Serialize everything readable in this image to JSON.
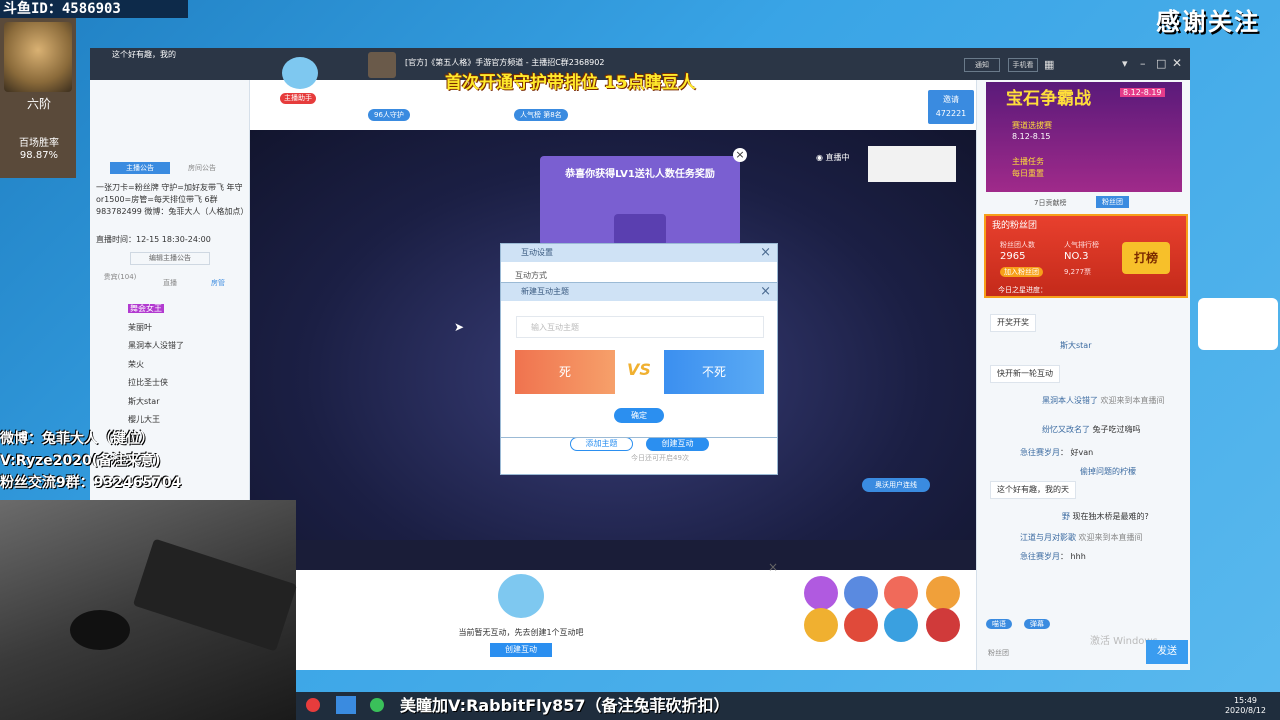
{
  "overlay": {
    "id_label": "斗鱼ID：4586903",
    "rank_label": "六阶",
    "winrate_label": "百场胜率",
    "winrate_value": "98.87%",
    "thank_text": "感谢关注",
    "banner_top": "首次开通守护带排位 15点瞎豆人",
    "weibo_line1": "微博：兔菲大人（键位）",
    "weibo_line2": "V:Ryze2020(备注来意)",
    "weibo_line3": "粉丝交流9群：932465704",
    "taskbar_text": "美瞳加V:RabbitFly857（备注兔菲砍折扣）"
  },
  "window": {
    "title": "[官方]《第五人格》手游官方频道 - 主播招C群2368902",
    "nick_badge": "主播助手",
    "guard": "96人守护",
    "popularity": "人气榜 第8名",
    "live_label": "直播中",
    "invite": "邀请",
    "invite_count": "472221",
    "notice_btn": "通知",
    "phone_btn": "手机看"
  },
  "left": {
    "greet": "这个好有趣，我的",
    "tab_notice": "主播公告",
    "tab_recent": "房间公告",
    "notice_text": "一张刀卡=粉丝牌 守护=加好友带飞 年守or1500=房管=每天排位带飞 6群983782499 微博：兔菲大人（人格加点）",
    "time_text": "直播时间：12-15 18:30-24:00",
    "edit_notice": "编辑主播公告",
    "tabs": [
      "贵宾(104)",
      "直播",
      "房管"
    ],
    "users": [
      "舞会女王",
      "茉丽叶",
      "黑洞本人没错了",
      "荣火",
      "拉比圣士侠",
      "斯大star",
      "樱儿大王",
      "鸣"
    ]
  },
  "reward": {
    "title": "恭喜你获得LV1送礼人数任务奖励"
  },
  "dialog_interact": {
    "title": "互动设置",
    "subtitle": "互动方式",
    "add": "添加主题",
    "create": "创建互动",
    "remain": "今日还可开启49次"
  },
  "dialog_new": {
    "title": "新建互动主题",
    "placeholder": "输入互动主题",
    "option_a": "死",
    "vs": "VS",
    "option_b": "不死",
    "confirm": "确定"
  },
  "bottom_panel": {
    "empty_text": "当前暂无互动，先去创建1个互动吧",
    "create_btn": "创建互动"
  },
  "fans": {
    "title": "我的粉丝团",
    "members_label": "粉丝团人数",
    "members": "2965",
    "rank_label": "人气排行榜",
    "rank": "NO.3",
    "join": "加入粉丝团",
    "rank_sub": "9,277票",
    "daka": "打榜",
    "today": "今日之星进度："
  },
  "promo": {
    "title": "宝石争霸战",
    "dates": "8.12-8.19",
    "line1": "赛道选拔赛",
    "line2": "8.12-8.15",
    "line3": "主播任务",
    "line4": "每日重置"
  },
  "right_tabs": [
    "7日贡献榜",
    "粉丝团"
  ],
  "chat": [
    {
      "user": "",
      "text": "开奖开奖"
    },
    {
      "user": "斯大star",
      "text": ""
    },
    {
      "user": "",
      "text": "快开新一轮互动"
    },
    {
      "user": "黑洞本人没错了",
      "text": "欢迎来到本直播间"
    },
    {
      "user": "纷忆又改名了",
      "text": "兔子吃过嗨吗"
    },
    {
      "user": "急往赛岁月",
      "text": "好van"
    },
    {
      "user": "偷掉问题的柠檬",
      "text": ""
    },
    {
      "user": "",
      "text": "这个好有趣，我的天"
    },
    {
      "user": "野",
      "text": "现在独木桥是最难的?"
    },
    {
      "user": "江道与月对影歌",
      "text": "欢迎来到本直播间"
    },
    {
      "user": "急往赛岁月",
      "text": "hhh"
    }
  ],
  "chat_input": {
    "btn_bullet": "喵语",
    "btn_color": "弹幕",
    "send": "发送",
    "fans_tag": "粉丝团",
    "watermark": "激活 Windows"
  },
  "service": "奥沃用户连线",
  "clock": {
    "time": "15:49",
    "date": "2020/8/12"
  }
}
